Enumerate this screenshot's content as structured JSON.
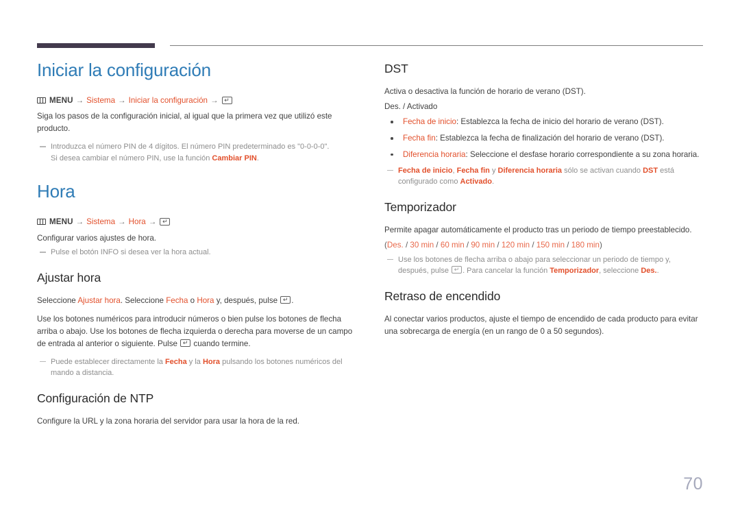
{
  "page": {
    "number": "70"
  },
  "left": {
    "section1": {
      "title": "Iniciar la configuración",
      "menu_label": "MENU",
      "path": [
        "Sistema",
        "Iniciar la configuración"
      ],
      "body": "Siga los pasos de la configuración inicial, al igual que la primera vez que utilizó este producto.",
      "note_line1": "Introduzca el número PIN de 4 dígitos. El número PIN predeterminado es \"0-0-0-0\".",
      "note_line2_pre": "Si desea cambiar el número PIN, use la función ",
      "note_line2_link": "Cambiar PIN",
      "note_line2_post": "."
    },
    "section2": {
      "title": "Hora",
      "menu_label": "MENU",
      "path": [
        "Sistema",
        "Hora"
      ],
      "body": "Configurar varios ajustes de hora.",
      "note": "Pulse el botón INFO si desea ver la hora actual."
    },
    "section3": {
      "title": "Ajustar hora",
      "p1_a": "Seleccione ",
      "p1_link1": "Ajustar hora",
      "p1_b": ". Seleccione ",
      "p1_link2": "Fecha",
      "p1_c": " o ",
      "p1_link3": "Hora",
      "p1_d": " y, después, pulse ",
      "p1_e": ".",
      "p2_a": "Use los botones numéricos para introducir números o bien pulse los botones de flecha arriba o abajo. Use los botones de flecha izquierda o derecha para moverse de un campo de entrada al anterior o siguiente. Pulse ",
      "p2_b": " cuando termine.",
      "note_a": "Puede establecer directamente la ",
      "note_link1": "Fecha",
      "note_b": " y la ",
      "note_link2": "Hora",
      "note_c": " pulsando los botones numéricos del mando a distancia."
    },
    "section4": {
      "title": "Configuración de NTP",
      "body": "Configure la URL y la zona horaria del servidor para usar la hora de la red."
    }
  },
  "right": {
    "section1": {
      "title": "DST",
      "body": "Activa o desactiva la función de horario de verano (DST).",
      "options": "Des. / Activado",
      "bullets": [
        {
          "term": "Fecha de inicio",
          "desc": ": Establezca la fecha de inicio del horario de verano (DST)."
        },
        {
          "term": "Fecha fin",
          "desc": ": Establezca la fecha de finalización del horario de verano (DST)."
        },
        {
          "term": "Diferencia horaria",
          "desc": ": Seleccione el desfase horario correspondiente a su zona horaria."
        }
      ],
      "note_t1": "Fecha de inicio",
      "note_s1": ", ",
      "note_t2": "Fecha fin",
      "note_s2": " y ",
      "note_t3": "Diferencia horaria",
      "note_s3": " sólo se activan cuando ",
      "note_t4": "DST",
      "note_s4": " está configurado como ",
      "note_t5": "Activado",
      "note_s5": "."
    },
    "section2": {
      "title": "Temporizador",
      "body": "Permite apagar automáticamente el producto tras un periodo de tiempo preestablecido.",
      "options": [
        "Des.",
        "30 min",
        "60 min",
        "90 min",
        "120 min",
        "150 min",
        "180 min"
      ],
      "note_a": "Use los botones de flecha arriba o abajo para seleccionar un periodo de tiempo y, después, pulse ",
      "note_b": ". Para cancelar la función ",
      "note_link1": "Temporizador",
      "note_c": ", seleccione ",
      "note_link2": "Des.",
      "note_d": "."
    },
    "section3": {
      "title": "Retraso de encendido",
      "body": "Al conectar varios productos, ajuste el tiempo de encendido de cada producto para evitar una sobrecarga de energía (en un rango de 0 a 50 segundos)."
    }
  },
  "icons": {
    "menu": "menu-grid-icon",
    "enter": "enter-key-icon",
    "arrow": "→"
  },
  "colors": {
    "heading_blue": "#2f7cb6",
    "accent_orange": "#e2502c",
    "option_orange": "#e8684a",
    "note_gray": "#8d8d8d",
    "rule_dark": "#433a4d"
  }
}
